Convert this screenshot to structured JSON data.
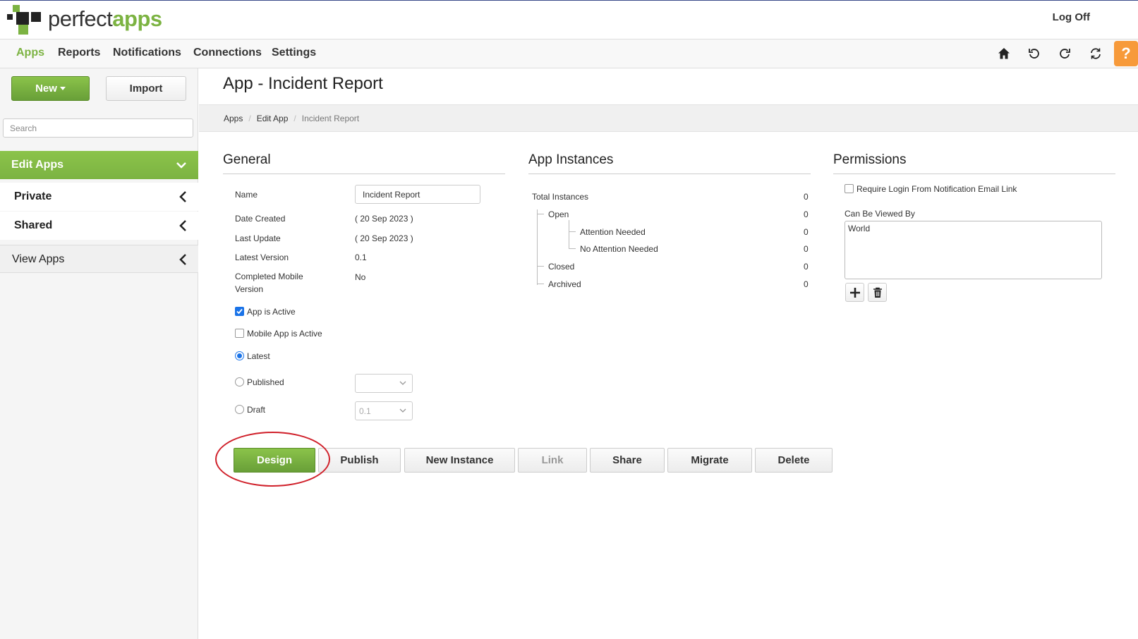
{
  "app": {
    "brand_part1": "perfect",
    "brand_part2": "apps",
    "logoff_label": "Log Off"
  },
  "menu": {
    "items": [
      "Apps",
      "Reports",
      "Notifications",
      "Connections",
      "Settings"
    ],
    "active": "Apps",
    "help_label": "?"
  },
  "toolbar_icons": [
    "home-icon",
    "undo-icon",
    "refresh-icon",
    "sync-icon"
  ],
  "sidebar": {
    "new_label": "New",
    "import_label": "Import",
    "search_placeholder": "Search",
    "edit_apps_label": "Edit Apps",
    "items": [
      "Private",
      "Shared"
    ],
    "view_apps_label": "View Apps"
  },
  "page": {
    "title": "App - Incident Report",
    "breadcrumb": [
      "Apps",
      "Edit App",
      "Incident Report"
    ]
  },
  "general": {
    "heading": "General",
    "name_label": "Name",
    "name_value": "Incident Report",
    "date_created_label": "Date Created",
    "date_created_value": "( 20 Sep 2023 )",
    "last_update_label": "Last Update",
    "last_update_value": "( 20 Sep 2023 )",
    "latest_version_label": "Latest Version",
    "latest_version_value": "0.1",
    "completed_mobile_label_1": "Completed Mobile",
    "completed_mobile_label_2": "Version",
    "completed_mobile_value": "No",
    "app_active_label": "App is Active",
    "mobile_active_label": "Mobile App is Active",
    "latest_label": "Latest",
    "published_label": "Published",
    "draft_label": "Draft",
    "draft_value": "0.1"
  },
  "instances": {
    "heading": "App Instances",
    "rows": [
      {
        "label": "Total Instances",
        "value": "0"
      },
      {
        "label": "Open",
        "value": "0"
      },
      {
        "label": "Attention Needed",
        "value": "0"
      },
      {
        "label": "No Attention Needed",
        "value": "0"
      },
      {
        "label": "Closed",
        "value": "0"
      },
      {
        "label": "Archived",
        "value": "0"
      }
    ]
  },
  "permissions": {
    "heading": "Permissions",
    "require_login_label": "Require Login From Notification Email Link",
    "viewed_by_label": "Can Be Viewed By",
    "viewed_by_value": "World"
  },
  "actions": [
    "Design",
    "Publish",
    "New Instance",
    "Link",
    "Share",
    "Migrate",
    "Delete"
  ],
  "colors": {
    "accent": "#7cb342",
    "help": "#f79a3a",
    "annotation": "#d0202a"
  }
}
